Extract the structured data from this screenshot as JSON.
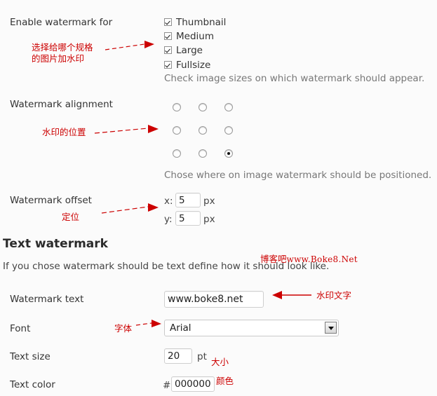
{
  "rows": {
    "enable": {
      "label": "Enable watermark for",
      "options": [
        {
          "label": "Thumbnail",
          "checked": true
        },
        {
          "label": "Medium",
          "checked": true
        },
        {
          "label": "Large",
          "checked": true
        },
        {
          "label": "Fullsize",
          "checked": true
        }
      ],
      "hint": "Check image sizes on which watermark should appear."
    },
    "alignment": {
      "label": "Watermark alignment",
      "hint": "Chose where on image watermark should be positioned.",
      "selected_cell": 8,
      "cells": 9
    },
    "offset": {
      "label": "Watermark offset",
      "x_prefix": "x:",
      "x_value": "5",
      "y_prefix": "y:",
      "y_value": "5",
      "unit": "px"
    },
    "text": {
      "label": "Watermark text",
      "value": "www.boke8.net"
    },
    "font": {
      "label": "Font",
      "value": "Arial",
      "options": [
        "Arial"
      ]
    },
    "size": {
      "label": "Text size",
      "value": "20",
      "unit": "pt"
    },
    "color": {
      "label": "Text color",
      "prefix": "#",
      "value": "000000"
    }
  },
  "section": {
    "heading": "Text watermark",
    "description": "If you chose watermark should be text define how it should look like."
  },
  "annotations": {
    "enable": "选择给哪个规格\n的图片加水印",
    "alignment": "水印的位置",
    "offset": "定位",
    "text": "水印文字",
    "font": "字体",
    "size": "大小",
    "color": "颜色"
  },
  "watermark_stamp": {
    "cn": "博客吧",
    "url": "www.Boke8.Net"
  },
  "colors": {
    "annotation": "#cc0000",
    "text": "#333333",
    "hint": "#777777",
    "background": "#fbfbfb"
  }
}
